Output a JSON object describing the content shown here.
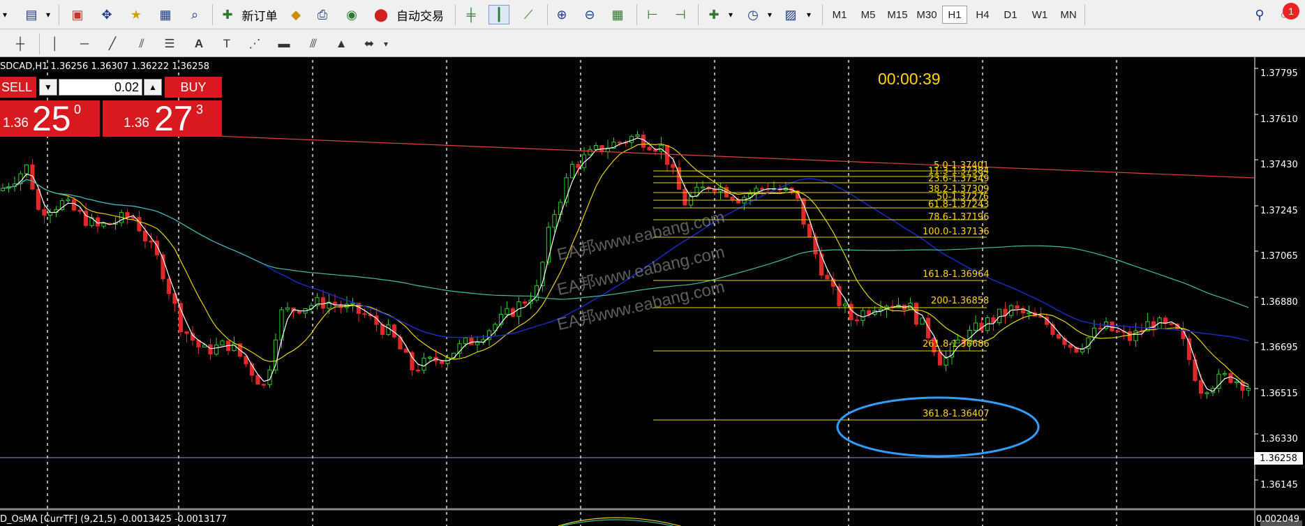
{
  "toolbar_main": {
    "new_order": "新订单",
    "auto_trading": "自动交易",
    "timeframes": [
      "M1",
      "M5",
      "M15",
      "M30",
      "H1",
      "H4",
      "D1",
      "W1",
      "MN"
    ],
    "active_timeframe": "H1",
    "notification_count": "1"
  },
  "chart": {
    "symbol_info": "SDCAD,H1  1.36256 1.36307 1.36222 1.36258",
    "timer": "00:00:39",
    "current_price": "1.36258",
    "price_axis": [
      "1.37795",
      "1.37610",
      "1.37430",
      "1.37245",
      "1.37065",
      "1.36880",
      "1.36695",
      "1.36515",
      "1.36330",
      "1.36145"
    ],
    "watermark": "EA邦www.eabang.com",
    "fib_levels": [
      "5.0-1.37401",
      "11.3-1.37384",
      "23.6-1.37349",
      "38.2-1.37309",
      "50-1.37276",
      "61.8-1.37243",
      "78.6-1.37196",
      "100.0-1.37136",
      "161.8-1.36964",
      "200-1.36858",
      "261.8-1.36686",
      "361.8-1.36407"
    ]
  },
  "trade_panel": {
    "sell_label": "SELL",
    "buy_label": "BUY",
    "lot": "0.02",
    "sell_small": "1.36",
    "sell_big": "25",
    "sell_sup": "0",
    "buy_small": "1.36",
    "buy_big": "27",
    "buy_sup": "3"
  },
  "osma": {
    "info": "D_OsMA [CurrTF] (9,21,5) -0.0013425 -0.0013177",
    "axis_value": "0.002049"
  }
}
